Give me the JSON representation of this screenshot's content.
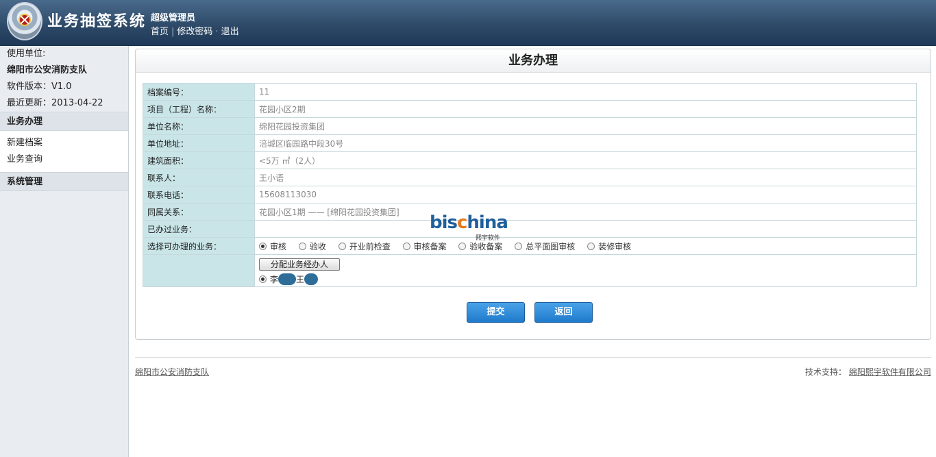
{
  "header": {
    "title": "业务抽签系统",
    "user_role": "超级管理员",
    "links": {
      "home": "首页",
      "change_password": "修改密码",
      "logout": "退出"
    }
  },
  "sidebar": {
    "info": {
      "unit_label": "使用单位:",
      "unit_name": "绵阳市公安消防支队",
      "version": "软件版本：V1.0",
      "updated": "最近更新：2013-04-22"
    },
    "sections": [
      {
        "title": "业务办理",
        "items": [
          "新建档案",
          "业务查询"
        ]
      },
      {
        "title": "系统管理",
        "items": []
      }
    ]
  },
  "main": {
    "title": "业务办理",
    "fields": [
      {
        "label": "档案编号：",
        "value": "11"
      },
      {
        "label": "项目（工程）名称：",
        "value": "花园小区2期"
      },
      {
        "label": "单位名称：",
        "value": "绵阳花园投资集团"
      },
      {
        "label": "单位地址：",
        "value": "涪城区临园路中段30号"
      },
      {
        "label": "建筑面积：",
        "value": "<5万 ㎡（2人）"
      },
      {
        "label": "联系人：",
        "value": "王小语"
      },
      {
        "label": "联系电话：",
        "value": "15608113030"
      },
      {
        "label": "同属关系：",
        "value": "花园小区1期 —— [绵阳花园投资集团]"
      },
      {
        "label": "已办过业务：",
        "value": ""
      }
    ],
    "business_label": "选择可办理的业务：",
    "business_options": [
      "审核",
      "验收",
      "开业前检查",
      "审核备案",
      "验收备案",
      "总平面图审核",
      "装修审核"
    ],
    "business_selected": "审核",
    "assign_button": "分配业务经办人",
    "handlers": {
      "first": "李",
      "second": "王"
    },
    "submit": "提交",
    "back": "返回"
  },
  "watermark": {
    "main_a": "bis",
    "main_b": "c",
    "main_c": "hina",
    "sub": "熙宇软件"
  },
  "footer": {
    "left": "绵阳市公安消防支队",
    "support_label": "技术支持：",
    "support_company": "绵阳熙宇软件有限公司"
  }
}
